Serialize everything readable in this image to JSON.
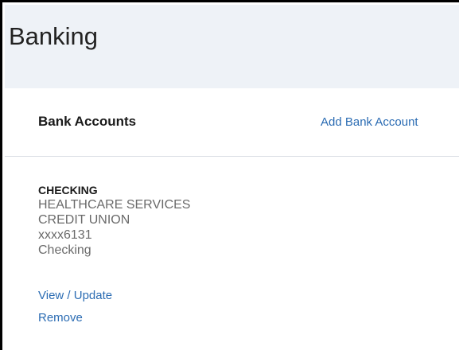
{
  "page": {
    "title": "Banking"
  },
  "section": {
    "title": "Bank Accounts",
    "add_label": "Add Bank Account"
  },
  "account": {
    "type": "CHECKING",
    "institution_line1": "HEALTHCARE SERVICES",
    "institution_line2": "CREDIT UNION",
    "masked_number": "xxxx6131",
    "account_kind": "Checking",
    "view_update_label": "View / Update",
    "remove_label": "Remove"
  }
}
